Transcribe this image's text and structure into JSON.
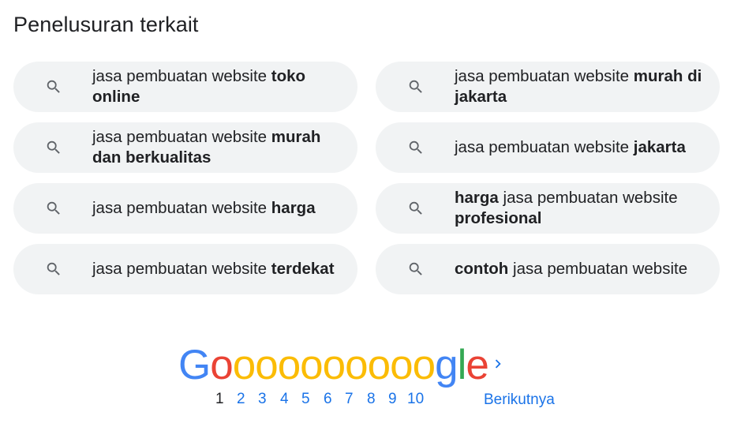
{
  "related": {
    "heading": "Penelusuran terkait",
    "items": [
      {
        "parts": [
          {
            "t": "jasa pembuatan website ",
            "b": false
          },
          {
            "t": "toko online",
            "b": true
          }
        ]
      },
      {
        "parts": [
          {
            "t": "jasa pembuatan website ",
            "b": false
          },
          {
            "t": "murah di jakarta",
            "b": true
          }
        ]
      },
      {
        "parts": [
          {
            "t": "jasa pembuatan website ",
            "b": false
          },
          {
            "t": "murah dan berkualitas",
            "b": true
          }
        ]
      },
      {
        "parts": [
          {
            "t": "jasa pembuatan website ",
            "b": false
          },
          {
            "t": "jakarta",
            "b": true
          }
        ]
      },
      {
        "parts": [
          {
            "t": "jasa pembuatan website ",
            "b": false
          },
          {
            "t": "harga",
            "b": true
          }
        ]
      },
      {
        "parts": [
          {
            "t": "harga",
            "b": true
          },
          {
            "t": " jasa pembuatan website ",
            "b": false
          },
          {
            "t": "profesional",
            "b": true
          }
        ]
      },
      {
        "parts": [
          {
            "t": "jasa pembuatan website ",
            "b": false
          },
          {
            "t": "terdekat",
            "b": true
          }
        ]
      },
      {
        "parts": [
          {
            "t": "contoh",
            "b": true
          },
          {
            "t": " jasa pembuatan website",
            "b": false
          }
        ]
      }
    ]
  },
  "pagination": {
    "logo_letters": [
      {
        "ch": "G",
        "color": "#4285f4"
      },
      {
        "ch": "o",
        "color": "#ea4335"
      },
      {
        "ch": "o",
        "color": "#fbbc05"
      },
      {
        "ch": "o",
        "color": "#fbbc05"
      },
      {
        "ch": "o",
        "color": "#fbbc05"
      },
      {
        "ch": "o",
        "color": "#fbbc05"
      },
      {
        "ch": "o",
        "color": "#fbbc05"
      },
      {
        "ch": "o",
        "color": "#fbbc05"
      },
      {
        "ch": "o",
        "color": "#fbbc05"
      },
      {
        "ch": "o",
        "color": "#fbbc05"
      },
      {
        "ch": "o",
        "color": "#fbbc05"
      },
      {
        "ch": "g",
        "color": "#4285f4"
      },
      {
        "ch": "l",
        "color": "#34a853"
      },
      {
        "ch": "e",
        "color": "#ea4335"
      }
    ],
    "pages": [
      "1",
      "2",
      "3",
      "4",
      "5",
      "6",
      "7",
      "8",
      "9",
      "10"
    ],
    "current_page": "1",
    "next_label": "Berikutnya",
    "next_icon": "chevron-right-icon"
  },
  "colors": {
    "link": "#1a73e8",
    "chip_bg": "#f1f3f4",
    "icon": "#5f6368",
    "text": "#202124"
  }
}
